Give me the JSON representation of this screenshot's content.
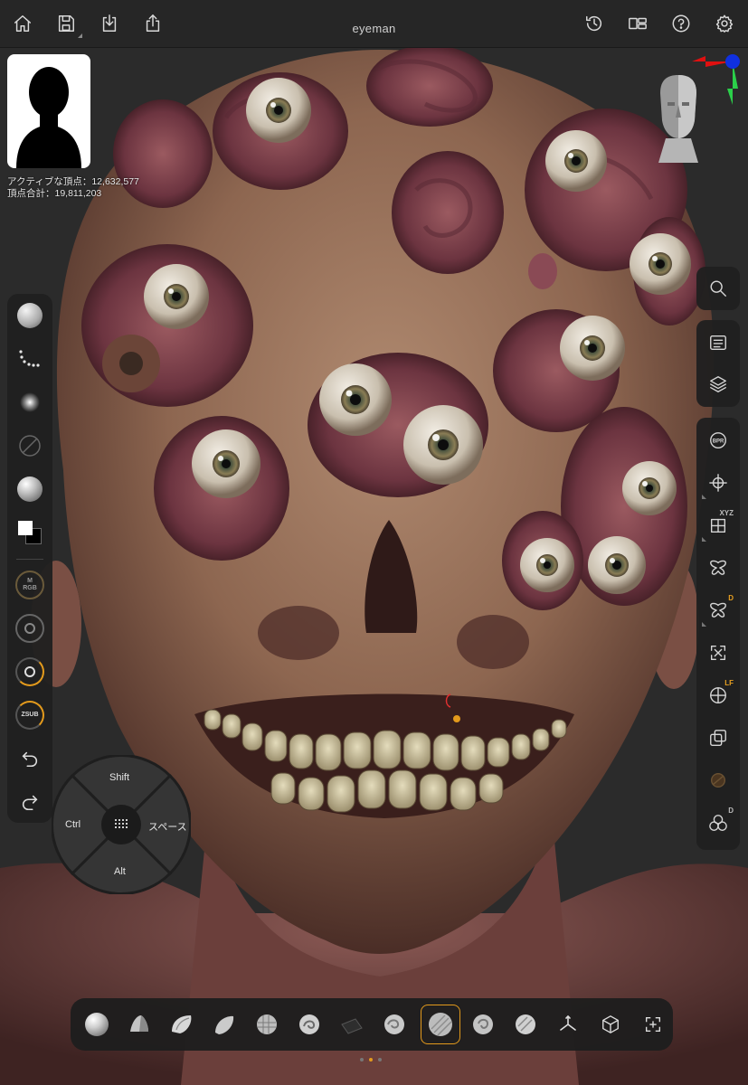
{
  "app": {
    "document_title": "eyeman"
  },
  "toolbar": {
    "left_icons": [
      "home-icon",
      "save-icon",
      "import-icon",
      "share-icon"
    ],
    "right_icons": [
      "history-icon",
      "layout-icon",
      "help-icon",
      "settings-icon"
    ]
  },
  "stats": {
    "active_points": "アクティブな頂点：12,632,577",
    "total_points": "頂点合計：19,811,203"
  },
  "left_panel": {
    "items": [
      {
        "name": "material-sphere-icon"
      },
      {
        "name": "stroke-dots-icon"
      },
      {
        "name": "alpha-falloff-icon"
      },
      {
        "name": "texture-off-icon"
      },
      {
        "name": "matcap-sphere-icon"
      },
      {
        "name": "color-swatch-icon"
      }
    ],
    "rgb_label": "M\nRGB",
    "sub_label_z": "Z",
    "sub_label": "SUB",
    "undo_icon": "undo-icon",
    "redo_icon": "redo-icon"
  },
  "right_panel": {
    "search_icon": "search-icon",
    "items": [
      {
        "name": "subtool-list-icon"
      },
      {
        "name": "layers-icon"
      },
      {
        "name": "bpr-render-icon",
        "label": "BPR"
      },
      {
        "name": "transpose-icon"
      },
      {
        "name": "symmetry-xyz-icon",
        "badge": "XYZ"
      },
      {
        "name": "mirror-icon"
      },
      {
        "name": "dynamic-symmetry-icon",
        "badge": "D"
      },
      {
        "name": "frame-icon"
      },
      {
        "name": "floor-grid-icon",
        "badge": "LF"
      },
      {
        "name": "polyframe-icon"
      },
      {
        "name": "solo-icon"
      },
      {
        "name": "dynamic-icon",
        "badge": "D"
      }
    ]
  },
  "modifier_wheel": {
    "top": "Shift",
    "left": "Ctrl",
    "right": "スペース",
    "bottom": "Alt"
  },
  "brush_bar": {
    "brushes": [
      "standard-brush-icon",
      "move-brush-icon",
      "clay-buildup-brush-icon",
      "inflate-brush-icon",
      "damstandard-brush-icon",
      "snakehook-brush-icon",
      "trim-brush-icon",
      "dam-brush-icon",
      "smooth-brush-icon",
      "pinch-brush-icon",
      "polish-brush-icon",
      "gizmo-icon",
      "mesh-cube-icon",
      "add-frame-icon"
    ],
    "active_index": 8,
    "page_dots": 3,
    "active_page": 1
  },
  "colors": {
    "accent": "#e39a1c",
    "panel": "#202020",
    "axis_x": "#e01010",
    "axis_y": "#2bd04a",
    "axis_z": "#1030e0"
  }
}
